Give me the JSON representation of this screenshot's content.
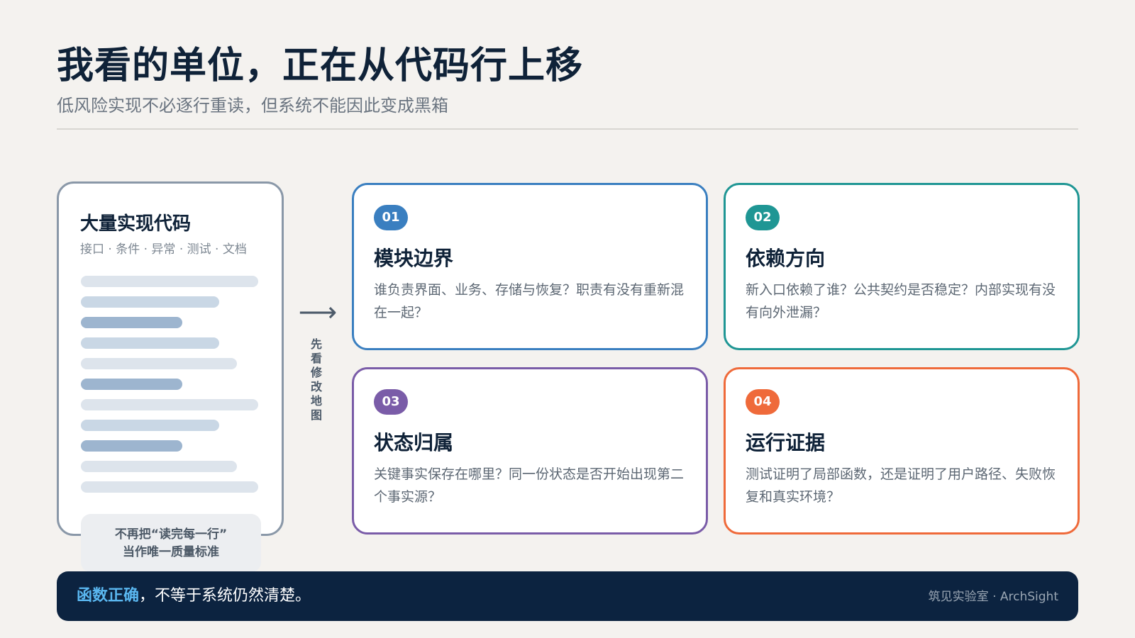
{
  "header": {
    "title": "我看的单位，正在从代码行上移",
    "subtitle": "低风险实现不必逐行重读，但系统不能因此变成黑箱"
  },
  "code_card": {
    "title": "大量实现代码",
    "subtitle": "接口 · 条件 · 异常 · 测试 · 文档",
    "note_line1": "不再把“读完每一行”",
    "note_line2": "当作唯一质量标准"
  },
  "arrow": {
    "glyph": "⟶",
    "label": "先看修改地图"
  },
  "cards": [
    {
      "num": "01",
      "title": "模块边界",
      "desc": "谁负责界面、业务、存储与恢复？职责有没有重新混在一起？",
      "color": "#3a7fc0"
    },
    {
      "num": "02",
      "title": "依赖方向",
      "desc": "新入口依赖了谁？公共契约是否稳定？内部实现有没有向外泄漏？",
      "color": "#1f9694"
    },
    {
      "num": "03",
      "title": "状态归属",
      "desc": "关键事实保存在哪里？同一份状态是否开始出现第二个事实源？",
      "color": "#7a5ca8"
    },
    {
      "num": "04",
      "title": "运行证据",
      "desc": "测试证明了局部函数，还是证明了用户路径、失败恢复和真实环境？",
      "color": "#ef6a3a"
    }
  ],
  "footer": {
    "highlight": "函数正确",
    "rest": "，不等于系统仍然清楚。",
    "brand": "筑见实验室 · ArchSight"
  }
}
